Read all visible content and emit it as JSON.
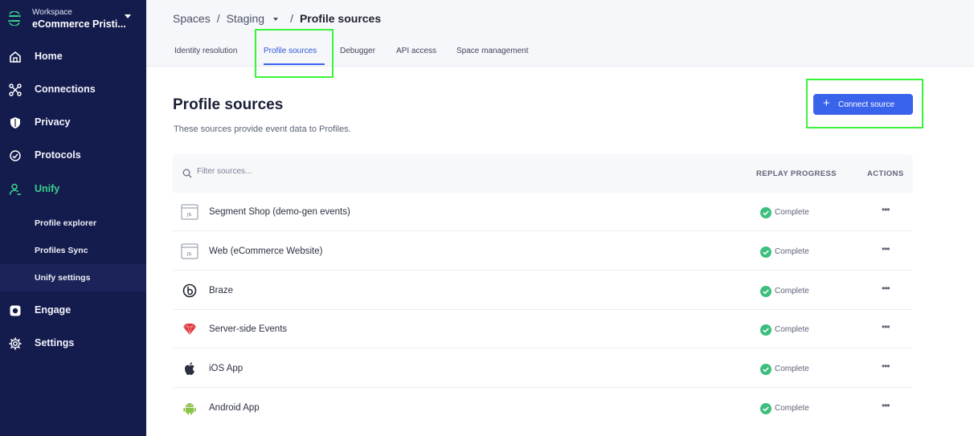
{
  "workspace": {
    "label": "Workspace",
    "name": "eCommerce Pristi..."
  },
  "sidebar": {
    "items": [
      {
        "label": "Home",
        "icon": "home-icon"
      },
      {
        "label": "Connections",
        "icon": "connections-icon"
      },
      {
        "label": "Privacy",
        "icon": "shield-icon"
      },
      {
        "label": "Protocols",
        "icon": "protocols-icon"
      },
      {
        "label": "Unify",
        "icon": "unify-icon",
        "active": true
      },
      {
        "label": "Engage",
        "icon": "engage-icon"
      },
      {
        "label": "Settings",
        "icon": "gear-icon"
      }
    ],
    "sub_items": [
      {
        "label": "Profile explorer"
      },
      {
        "label": "Profiles Sync"
      },
      {
        "label": "Unify settings",
        "selected": true
      }
    ]
  },
  "breadcrumb": {
    "spaces": "Spaces",
    "space": "Staging",
    "current": "Profile sources",
    "separator": "/"
  },
  "tabs": [
    {
      "label": "Identity resolution"
    },
    {
      "label": "Profile sources",
      "active": true
    },
    {
      "label": "Debugger"
    },
    {
      "label": "API access"
    },
    {
      "label": "Space management"
    }
  ],
  "main": {
    "title": "Profile sources",
    "subtitle": "These sources provide event data to Profiles.",
    "connect_button": "Connect source",
    "connect_icon": "plus-icon"
  },
  "table": {
    "filter_placeholder": "Filter sources...",
    "col_replay": "REPLAY PROGRESS",
    "col_actions": "ACTIONS",
    "rows": [
      {
        "name": "Segment Shop (demo-gen events)",
        "icon": "javascript-source-icon",
        "status": "Complete",
        "actions": "•••"
      },
      {
        "name": "Web (eCommerce Website)",
        "icon": "javascript-source-icon",
        "status": "Complete",
        "actions": "•••"
      },
      {
        "name": "Braze",
        "icon": "braze-icon",
        "status": "Complete",
        "actions": "•••"
      },
      {
        "name": "Server-side Events",
        "icon": "ruby-icon",
        "status": "Complete",
        "actions": "•••"
      },
      {
        "name": "iOS App",
        "icon": "apple-icon",
        "status": "Complete",
        "actions": "•••"
      },
      {
        "name": "Android App",
        "icon": "android-icon",
        "status": "Complete",
        "actions": "•••"
      }
    ]
  },
  "colors": {
    "sidebar_bg": "#141b4d",
    "accent": "#3a63ec",
    "active_nav": "#3ad18a",
    "status_ok": "#3cbf7c",
    "highlight": "#39f53a"
  }
}
